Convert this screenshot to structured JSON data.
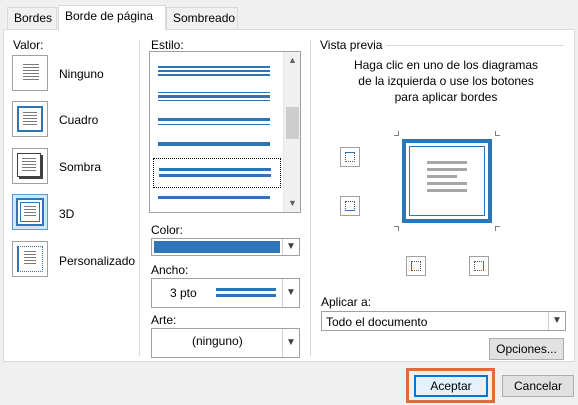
{
  "tabs": [
    {
      "label": "Bordes"
    },
    {
      "label": "Borde de página"
    },
    {
      "label": "Sombreado"
    }
  ],
  "valor": {
    "label": "Valor:",
    "items": [
      {
        "label": "Ninguno",
        "icon": "border-none-icon"
      },
      {
        "label": "Cuadro",
        "icon": "border-box-icon"
      },
      {
        "label": "Sombra",
        "icon": "border-shadow-icon"
      },
      {
        "label": "3D",
        "icon": "border-3d-icon",
        "selected": true
      },
      {
        "label": "Personalizado",
        "icon": "border-custom-icon"
      }
    ]
  },
  "estilo": {
    "label": "Estilo:"
  },
  "color": {
    "label": "Color:",
    "value_color": "#2e75b6"
  },
  "ancho": {
    "label": "Ancho:",
    "value": "3 pto"
  },
  "arte": {
    "label": "Arte:",
    "value": "(ninguno)"
  },
  "preview": {
    "label": "Vista previa",
    "hint": "Haga clic en uno de los diagramas de la izquierda o use los botones para aplicar bordes"
  },
  "aplicar": {
    "label": "Aplicar a:",
    "value": "Todo el documento"
  },
  "buttons": {
    "opciones": "Opciones...",
    "aceptar": "Aceptar",
    "cancelar": "Cancelar"
  },
  "colors": {
    "accent": "#2e75b6",
    "highlight_outline": "#e06b3a"
  }
}
